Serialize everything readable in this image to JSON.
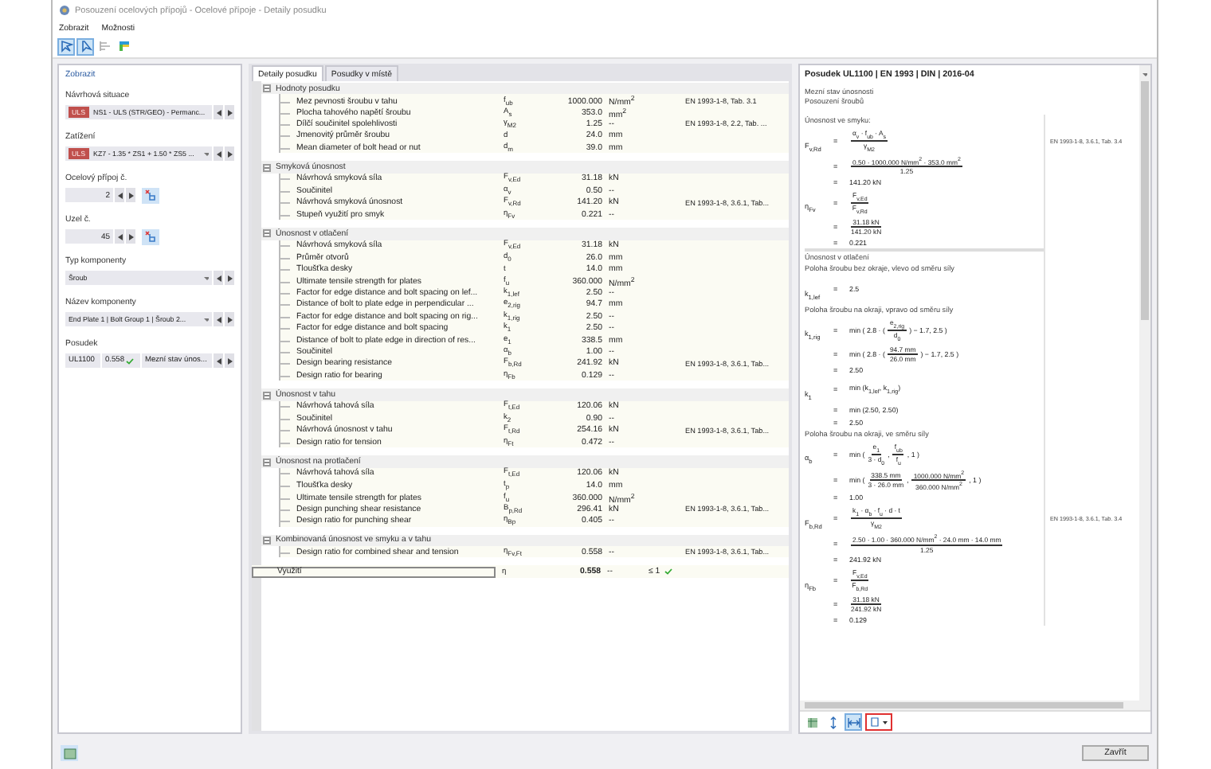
{
  "window": {
    "title": "Posouzení ocelových přípojů - Ocelové přípoje - Detaily posudku"
  },
  "menu": [
    "Zobrazit",
    "Možnosti"
  ],
  "toolbar": [
    {
      "kind": "select",
      "selected": true
    },
    {
      "kind": "pick",
      "selected": true
    },
    {
      "kind": "list",
      "selected": false
    },
    {
      "kind": "color",
      "selected": false
    }
  ],
  "left_panel": {
    "header": "Zobrazit",
    "fields": [
      {
        "label": "Návrhová situace",
        "kind": "tagged",
        "tag": "ULS",
        "value": "NS1 - ULS (STR/GEO) - Permanc..."
      },
      {
        "label": "Zatížení",
        "kind": "tagged",
        "tag": "ULS",
        "value": "KZ7 - 1.35 * ZS1 + 1.50 * ZS5 ...",
        "dropdown": true
      },
      {
        "label": "Ocelový přípoj č.",
        "kind": "spin",
        "value": "2"
      },
      {
        "label": "Uzel č.",
        "kind": "spin",
        "value": "45"
      },
      {
        "label": "Typ komponenty",
        "kind": "combo",
        "value": "Šroub"
      },
      {
        "label": "Název komponenty",
        "kind": "combo",
        "value": "End Plate 1 | Bolt Group 1 | Šroub 2..."
      },
      {
        "label": "Posudek",
        "kind": "result",
        "code": "UL1100",
        "ratio": "0.558",
        "ok": true,
        "value": "Mezní stav únos..."
      }
    ]
  },
  "tabs": [
    {
      "label": "Detaily posudku",
      "selected": true
    },
    {
      "label": "Posudky v místě",
      "selected": false
    }
  ],
  "groups": [
    {
      "title": "Hodnoty posudku",
      "expanded": true,
      "rows": [
        {
          "name": "Mez pevnosti šroubu v tahu",
          "symbol": "f$_{ub}$",
          "value": "1000.000",
          "unit": "N/mm$^{2}$",
          "reference": "EN 1993-1-8, Tab. 3.1"
        },
        {
          "name": "Plocha tahového napětí šroubu",
          "symbol": "A$_{s}$",
          "value": "353.0",
          "unit": "mm$^{2}$"
        },
        {
          "name": "Dílčí součinitel spolehlivosti",
          "symbol": "γ$_{M2}$",
          "value": "1.25",
          "unit": "--",
          "reference": "EN 1993-1-8, 2.2, Tab. ..."
        },
        {
          "name": "Jmenovitý průměr šroubu",
          "symbol": "d",
          "value": "24.0",
          "unit": "mm"
        },
        {
          "name": "Mean diameter of bolt head or nut",
          "symbol": "d$_{m}$",
          "value": "39.0",
          "unit": "mm"
        }
      ]
    },
    {
      "title": "Smyková únosnost",
      "expanded": true,
      "rows": [
        {
          "name": "Návrhová smyková síla",
          "symbol": "F$_{v,Ed}$",
          "value": "31.18",
          "unit": "kN"
        },
        {
          "name": "Součinitel",
          "symbol": "α$_{v}$",
          "value": "0.50",
          "unit": "--"
        },
        {
          "name": "Návrhová smyková únosnost",
          "symbol": "F$_{v,Rd}$",
          "value": "141.20",
          "unit": "kN",
          "reference": "EN 1993-1-8, 3.6.1, Tab..."
        },
        {
          "name": "Stupeň využití pro smyk",
          "symbol": "η$_{Fv}$",
          "value": "0.221",
          "unit": "--"
        }
      ]
    },
    {
      "title": "Únosnost v otlačení",
      "expanded": true,
      "rows": [
        {
          "name": "Návrhová smyková síla",
          "symbol": "F$_{v,Ed}$",
          "value": "31.18",
          "unit": "kN"
        },
        {
          "name": "Průměr otvorů",
          "symbol": "d$_{0}$",
          "value": "26.0",
          "unit": "mm"
        },
        {
          "name": "Tloušťka desky",
          "symbol": "t",
          "value": "14.0",
          "unit": "mm"
        },
        {
          "name": "Ultimate tensile strength for plates",
          "symbol": "f$_{u}$",
          "value": "360.000",
          "unit": "N/mm$^{2}$"
        },
        {
          "name": "Factor for edge distance and bolt spacing on lef...",
          "symbol": "k$_{1,lef}$",
          "value": "2.50",
          "unit": "--"
        },
        {
          "name": "Distance of bolt to plate edge in perpendicular ...",
          "symbol": "e$_{2,rig}$",
          "value": "94.7",
          "unit": "mm"
        },
        {
          "name": "Factor for edge distance and bolt spacing on rig...",
          "symbol": "k$_{1,rig}$",
          "value": "2.50",
          "unit": "--"
        },
        {
          "name": "Factor for edge distance and bolt spacing",
          "symbol": "k$_{1}$",
          "value": "2.50",
          "unit": "--"
        },
        {
          "name": "Distance of bolt to plate edge in direction of res...",
          "symbol": "e$_{1}$",
          "value": "338.5",
          "unit": "mm"
        },
        {
          "name": "Součinitel",
          "symbol": "α$_{b}$",
          "value": "1.00",
          "unit": "--"
        },
        {
          "name": "Design bearing resistance",
          "symbol": "F$_{b,Rd}$",
          "value": "241.92",
          "unit": "kN",
          "reference": "EN 1993-1-8, 3.6.1, Tab..."
        },
        {
          "name": "Design ratio for bearing",
          "symbol": "η$_{Fb}$",
          "value": "0.129",
          "unit": "--"
        }
      ]
    },
    {
      "title": "Únosnost v tahu",
      "expanded": true,
      "rows": [
        {
          "name": "Návrhová tahová síla",
          "symbol": "F$_{t,Ed}$",
          "value": "120.06",
          "unit": "kN"
        },
        {
          "name": "Součinitel",
          "symbol": "k$_{2}$",
          "value": "0.90",
          "unit": "--"
        },
        {
          "name": "Návrhová únosnost v tahu",
          "symbol": "F$_{t,Rd}$",
          "value": "254.16",
          "unit": "kN",
          "reference": "EN 1993-1-8, 3.6.1, Tab..."
        },
        {
          "name": "Design ratio for tension",
          "symbol": "η$_{Ft}$",
          "value": "0.472",
          "unit": "--"
        }
      ]
    },
    {
      "title": "Únosnost na protlačení",
      "expanded": true,
      "rows": [
        {
          "name": "Návrhová tahová síla",
          "symbol": "F$_{t,Ed}$",
          "value": "120.06",
          "unit": "kN"
        },
        {
          "name": "Tloušťka desky",
          "symbol": "t$_{p}$",
          "value": "14.0",
          "unit": "mm"
        },
        {
          "name": "Ultimate tensile strength for plates",
          "symbol": "f$_{u}$",
          "value": "360.000",
          "unit": "N/mm$^{2}$"
        },
        {
          "name": "Design punching shear resistance",
          "symbol": "B$_{p,Rd}$",
          "value": "296.41",
          "unit": "kN",
          "reference": "EN 1993-1-8, 3.6.1, Tab..."
        },
        {
          "name": "Design ratio for punching shear",
          "symbol": "η$_{Bp}$",
          "value": "0.405",
          "unit": "--"
        }
      ]
    },
    {
      "title": "Kombinovaná únosnost ve smyku a v tahu",
      "expanded": true,
      "rows": [
        {
          "name": "Design ratio for combined shear and tension",
          "symbol": "η$_{Fv,Ft}$",
          "value": "0.558",
          "unit": "--",
          "reference": "EN 1993-1-8, 3.6.1, Tab..."
        }
      ]
    }
  ],
  "total": {
    "name": "Využití",
    "symbol": "η",
    "value": "0.558",
    "unit": "--",
    "limit": "≤ 1",
    "ok": true
  },
  "report": {
    "title": "Posudek UL1100 | EN 1993 | DIN | 2016-04",
    "subtitle": [
      "Mezní stav únosnosti",
      "Posouzení šroubů"
    ],
    "sections": [
      {
        "heading": "Únosnost ve smyku:",
        "lines": [
          {
            "kind": "eq",
            "sign": "=",
            "lhs": "F$_{v,Rd}$",
            "parts": [
              {
                "num": "α$_{v}$ · f$_{ub}$ · A$_{s}$",
                "den": "γ$_{M2}$"
              }
            ],
            "reference": "EN 1993-1-8, 3.6.1, Tab. 3.4"
          },
          {
            "kind": "eq",
            "sign": "=",
            "parts": [
              {
                "num": "0.50 · 1000.000 N/mm$^{2}$ · 353.0 mm$^{2}$",
                "den": "1.25"
              }
            ]
          },
          {
            "kind": "eq",
            "sign": "=",
            "parts": [
              {
                "text": "141.20 kN"
              }
            ]
          },
          {
            "kind": "eq",
            "sign": "=",
            "lhs": "η$_{Fv}$",
            "parts": [
              {
                "num": "F$_{v,Ed}$",
                "den": "F$_{v,Rd}$"
              }
            ]
          },
          {
            "kind": "eq",
            "sign": "=",
            "parts": [
              {
                "num": "31.18 kN",
                "den": "141.20 kN"
              }
            ]
          },
          {
            "kind": "eq",
            "sign": "=",
            "parts": [
              {
                "text": "0.221"
              }
            ]
          }
        ]
      },
      {
        "heading": "Únosnost v otlačení",
        "lines": [
          {
            "kind": "text",
            "text": "Poloha šroubu bez okraje, vlevo od směru síly"
          },
          {
            "kind": "eq",
            "sign": "=",
            "lhs": "k$_{1,lef}$",
            "parts": [
              {
                "text": "2.5"
              }
            ]
          },
          {
            "kind": "text",
            "text": "Poloha šroubu na okraji, vpravo od směru síly"
          },
          {
            "kind": "eq",
            "sign": "=",
            "lhs": "k$_{1,rig}$",
            "parts": [
              {
                "text": "min ( 2.8 · ("
              },
              {
                "num": "e$_{2,rig}$",
                "den": "d$_{0}$"
              },
              {
                "text": ") − 1.7, 2.5 )"
              }
            ]
          },
          {
            "kind": "eq",
            "sign": "=",
            "parts": [
              {
                "text": "min ( 2.8 · ("
              },
              {
                "num": "94.7 mm",
                "den": "26.0 mm"
              },
              {
                "text": ") − 1.7, 2.5 )"
              }
            ]
          },
          {
            "kind": "eq",
            "sign": "=",
            "parts": [
              {
                "text": "2.50"
              }
            ]
          },
          {
            "kind": "eq",
            "sign": "=",
            "lhs": "k$_{1}$",
            "parts": [
              {
                "text": "min (k$_{1,lef}$, k$_{1,rig}$)"
              }
            ]
          },
          {
            "kind": "eq",
            "sign": "=",
            "parts": [
              {
                "text": "min (2.50, 2.50)"
              }
            ]
          },
          {
            "kind": "eq",
            "sign": "=",
            "parts": [
              {
                "text": "2.50"
              }
            ]
          },
          {
            "kind": "text",
            "text": "Poloha šroubu na okraji, ve směru síly"
          },
          {
            "kind": "eq",
            "sign": "=",
            "lhs": "α$_{b}$",
            "parts": [
              {
                "text": "min ("
              },
              {
                "num": "e$_{1}$",
                "den": "3 · d$_{0}$"
              },
              {
                "text": ","
              },
              {
                "num": "f$_{ub}$",
                "den": "f$_{u}$"
              },
              {
                "text": ", 1 )"
              }
            ]
          },
          {
            "kind": "eq",
            "sign": "=",
            "parts": [
              {
                "text": "min ("
              },
              {
                "num": "338.5 mm",
                "den": "3 · 26.0 mm"
              },
              {
                "text": ","
              },
              {
                "num": "1000.000 N/mm$^{2}$",
                "den": "360.000 N/mm$^{2}$"
              },
              {
                "text": ", 1 )"
              }
            ]
          },
          {
            "kind": "eq",
            "sign": "=",
            "parts": [
              {
                "text": "1.00"
              }
            ]
          },
          {
            "kind": "eq",
            "sign": "=",
            "lhs": "F$_{b,Rd}$",
            "parts": [
              {
                "num": "k$_{1}$ · α$_{b}$ · f$_{u}$ · d · t",
                "den": "γ$_{M2}$"
              }
            ],
            "reference": "EN 1993-1-8, 3.6.1, Tab. 3.4"
          },
          {
            "kind": "eq",
            "sign": "=",
            "parts": [
              {
                "num": "2.50 · 1.00 · 360.000 N/mm$^{2}$ · 24.0 mm · 14.0 mm",
                "den": "1.25"
              }
            ]
          },
          {
            "kind": "eq",
            "sign": "=",
            "parts": [
              {
                "text": "241.92 kN"
              }
            ]
          },
          {
            "kind": "eq",
            "sign": "=",
            "lhs": "η$_{Fb}$",
            "parts": [
              {
                "num": "F$_{v,Ed}$",
                "den": "F$_{b,Rd}$"
              }
            ]
          },
          {
            "kind": "eq",
            "sign": "=",
            "parts": [
              {
                "num": "31.18 kN",
                "den": "241.92 kN"
              }
            ]
          },
          {
            "kind": "eq",
            "sign": "=",
            "parts": [
              {
                "text": "0.129"
              }
            ]
          }
        ]
      }
    ]
  },
  "report_tools": [
    {
      "kind": "export",
      "selected": false
    },
    {
      "kind": "fit",
      "selected": false
    },
    {
      "kind": "width",
      "selected": true
    },
    {
      "kind": "units",
      "selected": false,
      "highlighted": true
    }
  ],
  "footer": {
    "close": "Zavřít"
  }
}
